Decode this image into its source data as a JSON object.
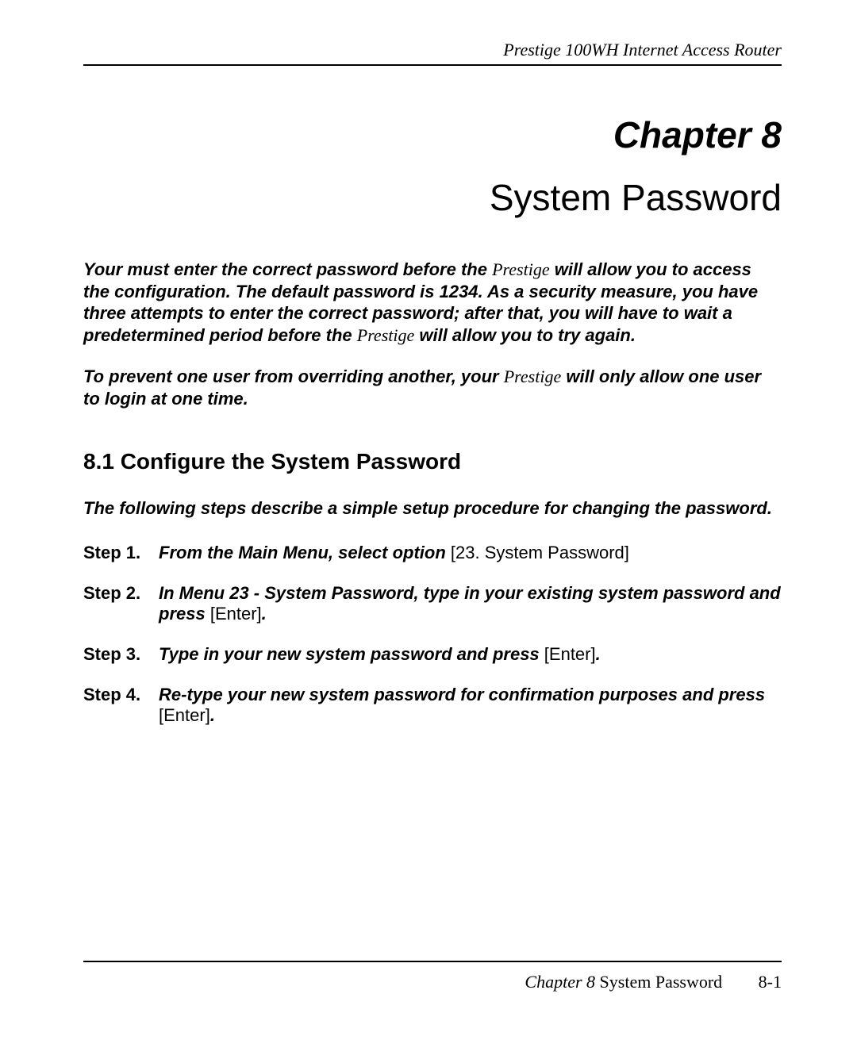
{
  "header": {
    "text": "Prestige 100WH Internet Access Router"
  },
  "chapter": {
    "title": "Chapter 8",
    "subtitle": "System Password"
  },
  "intro": {
    "para1_part1": "Your must enter the correct password before the",
    "para1_prestige1": "Prestige",
    "para1_part2": "will allow you to access the configuration. The default password is 1234. As a security measure, you have three attempts to enter the correct password; after that, you will have to wait a predetermined period before the",
    "para1_prestige2": "Prestige",
    "para1_part3": " will allow you to try again.",
    "para2_part1": "To prevent one user from overriding another, your",
    "para2_prestige": "Prestige",
    "para2_part2": "will only allow one user to login at one time."
  },
  "section": {
    "heading": "8.1    Configure the System Password",
    "intro": "The following steps describe a simple setup procedure for changing the password."
  },
  "steps": [
    {
      "label": "Step 1.",
      "bold_italic": "From the Main Menu, select option",
      "regular": " [23. System Password]"
    },
    {
      "label": "Step 2.",
      "bold_italic": "In Menu 23 - System Password, type in your existing system password and press ",
      "regular": "[Enter]",
      "bold_italic_end": "."
    },
    {
      "label": "Step 3.",
      "bold_italic": "Type in your new system password and press ",
      "regular": "[Enter]",
      "bold_italic_end": "."
    },
    {
      "label": "Step 4.",
      "bold_italic": "Re-type your new system password for confirmation purposes and press ",
      "regular": "[Enter]",
      "bold_italic_end": "."
    }
  ],
  "footer": {
    "chapter_label": "Chapter 8",
    "chapter_name": " System Password",
    "page_num": "8-1"
  }
}
